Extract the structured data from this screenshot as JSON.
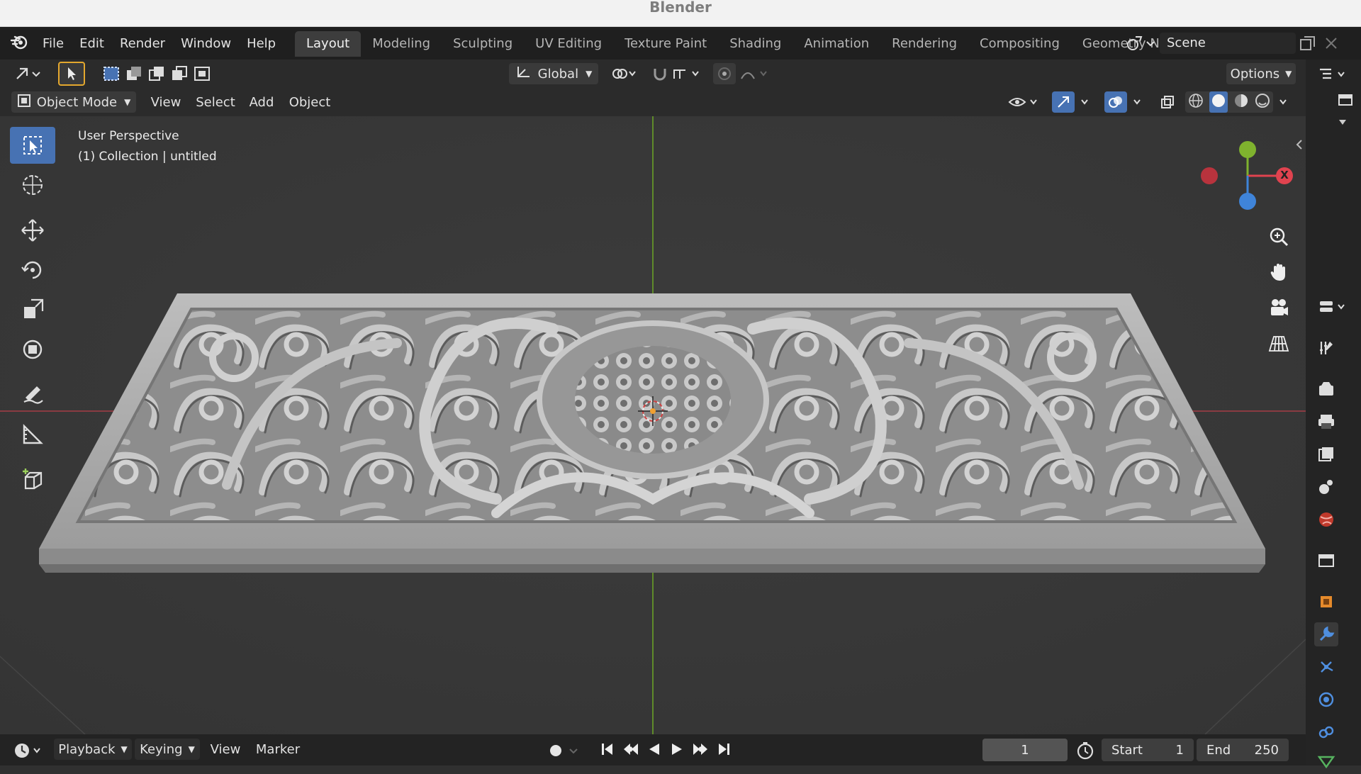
{
  "window": {
    "title": "Blender"
  },
  "menu": [
    "File",
    "Edit",
    "Render",
    "Window",
    "Help"
  ],
  "workspaces": {
    "active": "Layout",
    "tabs": [
      "Layout",
      "Modeling",
      "Sculpting",
      "UV Editing",
      "Texture Paint",
      "Shading",
      "Animation",
      "Rendering",
      "Compositing",
      "Geometry Nod"
    ]
  },
  "scene": {
    "name": "Scene"
  },
  "tool_header": {
    "orientation": "Global",
    "options": "Options"
  },
  "viewport_header": {
    "mode": "Object Mode",
    "menus": [
      "View",
      "Select",
      "Add",
      "Object"
    ]
  },
  "viewport": {
    "perspective": "User Perspective",
    "collection": "(1) Collection | untitled",
    "axes": {
      "x": "X"
    }
  },
  "timeline": {
    "menus": [
      "Playback",
      "Keying",
      "View",
      "Marker"
    ],
    "current_frame": "1",
    "start_label": "Start",
    "start": "1",
    "end_label": "End",
    "end": "250"
  },
  "colors": {
    "accent": "#4772b3",
    "x_axis": "#e0434f",
    "y_axis": "#7fb22e",
    "z_axis": "#3f84d9"
  }
}
